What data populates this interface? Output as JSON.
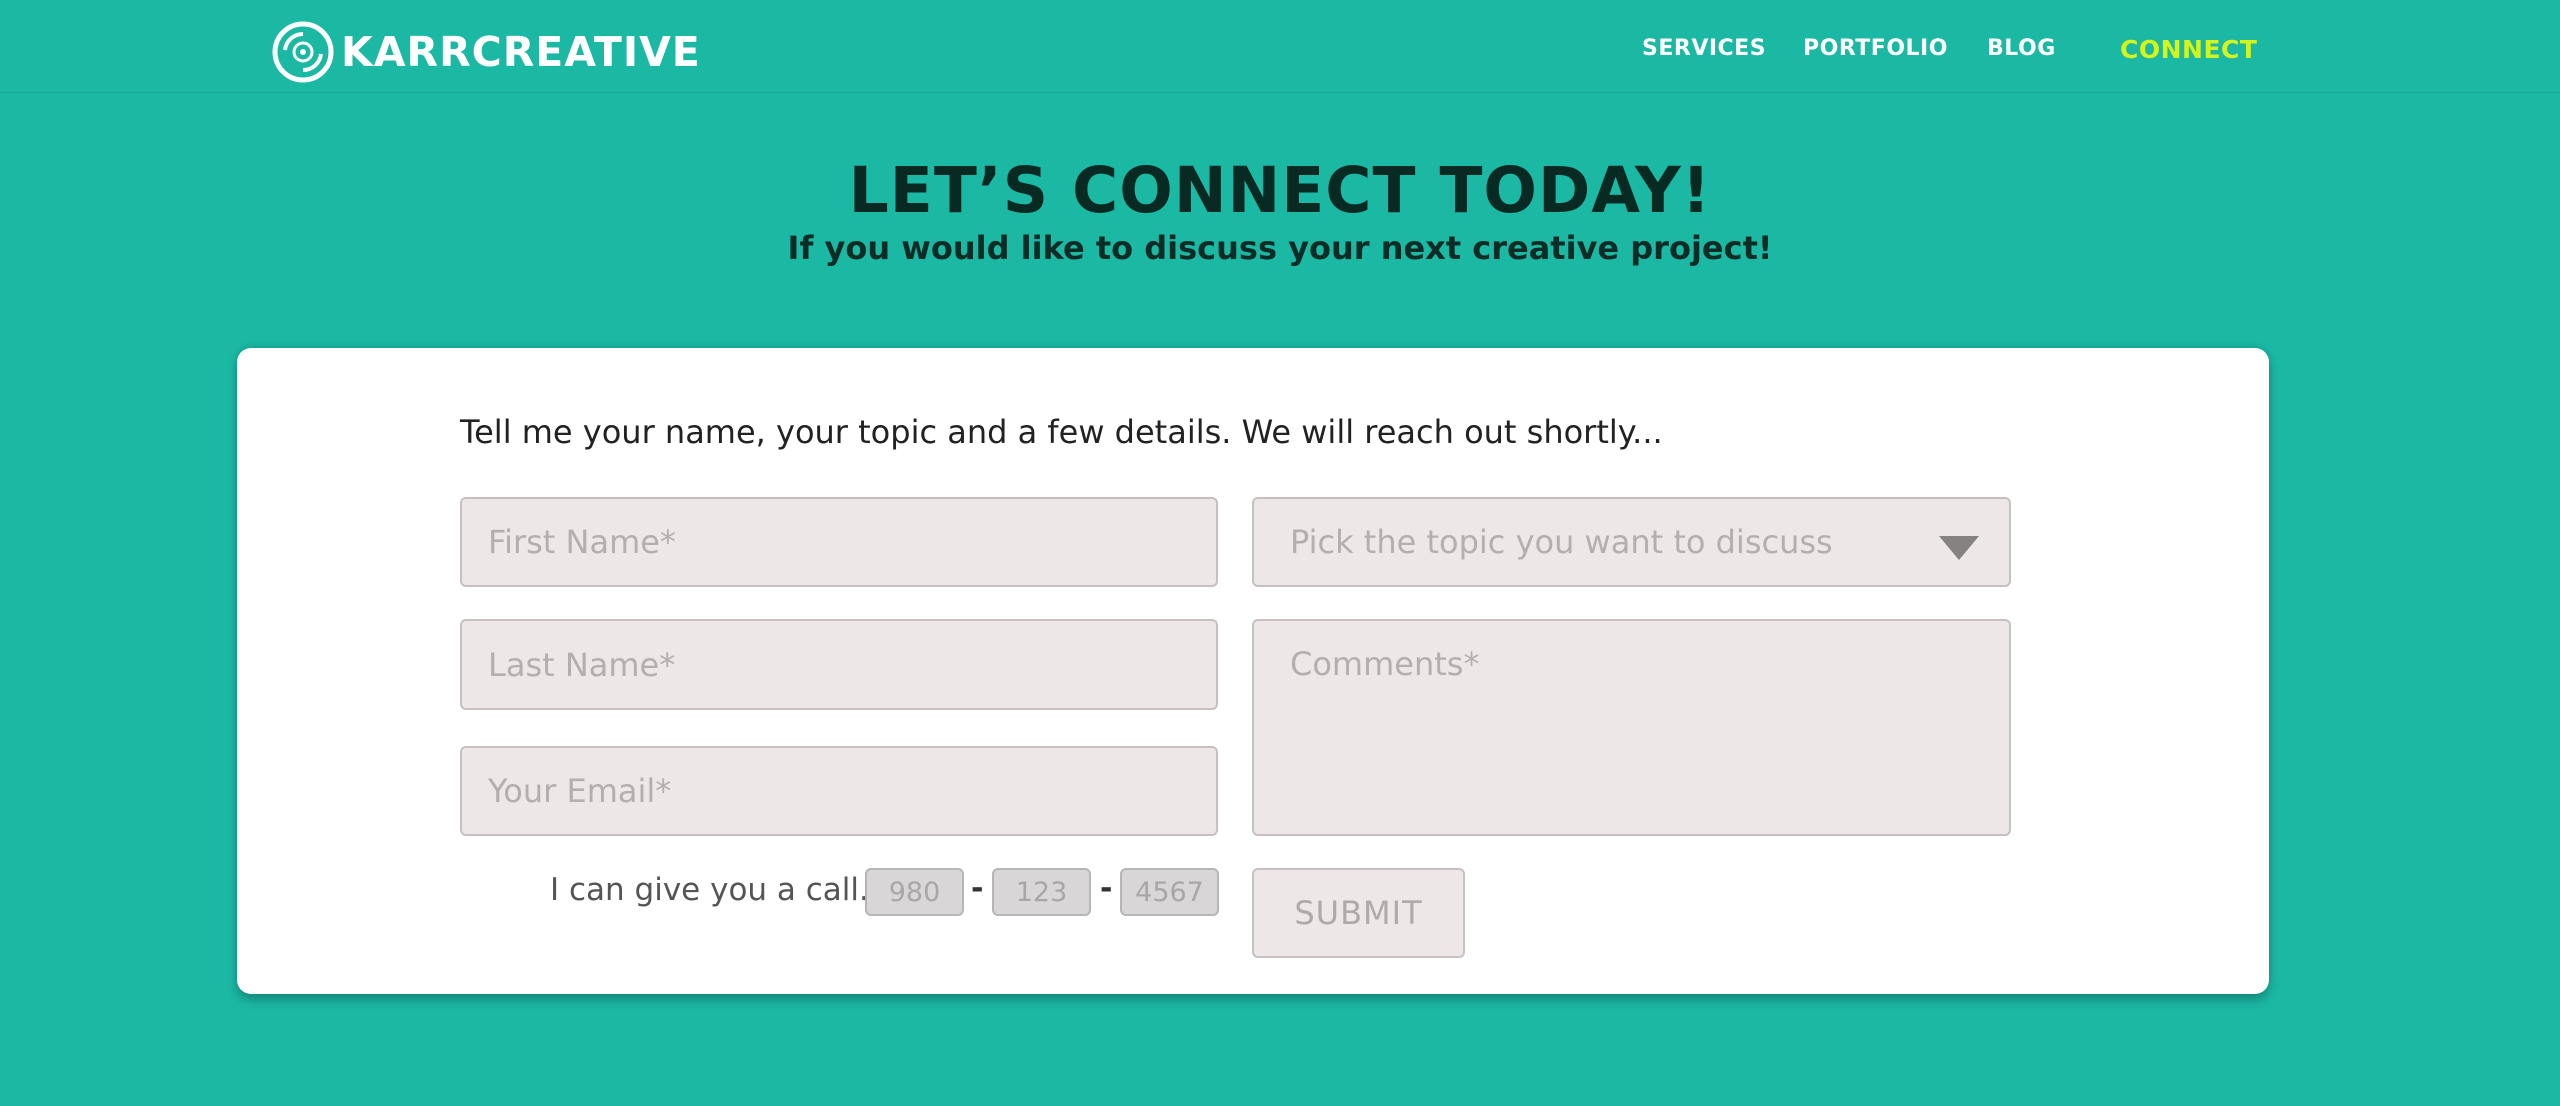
{
  "brand": {
    "name": "KARRCREATIVE",
    "logo_icon": "disc-logo-icon"
  },
  "nav": {
    "items": [
      {
        "label": "SERVICES"
      },
      {
        "label": "PORTFOLIO"
      },
      {
        "label": "BLOG"
      },
      {
        "label": "CONNECT"
      }
    ],
    "active": "CONNECT"
  },
  "hero": {
    "title": "LET’S CONNECT TODAY!",
    "subtitle": "If you would like to discuss your next creative project!"
  },
  "form": {
    "intro": "Tell me your name, your topic and a few details. We will reach out shortly...",
    "first_name": {
      "placeholder": "First Name*"
    },
    "last_name": {
      "placeholder": "Last Name*"
    },
    "email": {
      "placeholder": "Your Email*"
    },
    "topic": {
      "placeholder": "Pick the topic you want to discuss",
      "caret_icon": "caret-down-icon"
    },
    "comments": {
      "placeholder": "Comments*"
    },
    "call_label": "I can give you a call...",
    "phone": {
      "area": "980",
      "prefix": "123",
      "line": "4567",
      "separator": "-"
    },
    "submit_label": "SUBMIT"
  },
  "colors": {
    "background": "#1bb8a4",
    "nav_active": "#d4f51c",
    "title": "#082a22",
    "field_bg": "#ede7e7"
  }
}
